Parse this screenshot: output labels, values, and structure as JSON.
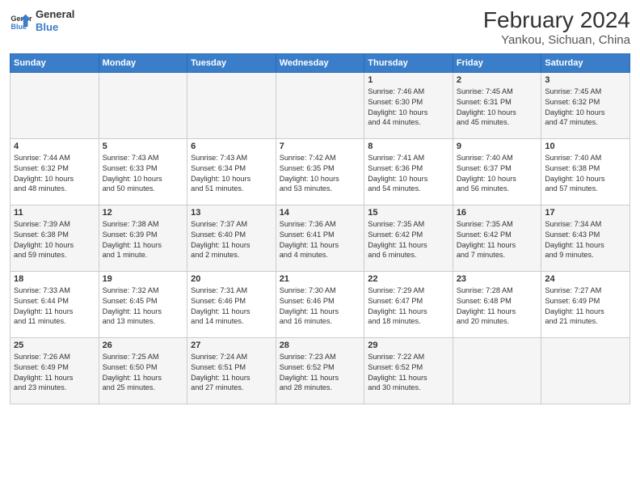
{
  "logo": {
    "line1": "General",
    "line2": "Blue"
  },
  "title": "February 2024",
  "subtitle": "Yankou, Sichuan, China",
  "days_of_week": [
    "Sunday",
    "Monday",
    "Tuesday",
    "Wednesday",
    "Thursday",
    "Friday",
    "Saturday"
  ],
  "weeks": [
    [
      {
        "day": "",
        "info": ""
      },
      {
        "day": "",
        "info": ""
      },
      {
        "day": "",
        "info": ""
      },
      {
        "day": "",
        "info": ""
      },
      {
        "day": "1",
        "info": "Sunrise: 7:46 AM\nSunset: 6:30 PM\nDaylight: 10 hours\nand 44 minutes."
      },
      {
        "day": "2",
        "info": "Sunrise: 7:45 AM\nSunset: 6:31 PM\nDaylight: 10 hours\nand 45 minutes."
      },
      {
        "day": "3",
        "info": "Sunrise: 7:45 AM\nSunset: 6:32 PM\nDaylight: 10 hours\nand 47 minutes."
      }
    ],
    [
      {
        "day": "4",
        "info": "Sunrise: 7:44 AM\nSunset: 6:32 PM\nDaylight: 10 hours\nand 48 minutes."
      },
      {
        "day": "5",
        "info": "Sunrise: 7:43 AM\nSunset: 6:33 PM\nDaylight: 10 hours\nand 50 minutes."
      },
      {
        "day": "6",
        "info": "Sunrise: 7:43 AM\nSunset: 6:34 PM\nDaylight: 10 hours\nand 51 minutes."
      },
      {
        "day": "7",
        "info": "Sunrise: 7:42 AM\nSunset: 6:35 PM\nDaylight: 10 hours\nand 53 minutes."
      },
      {
        "day": "8",
        "info": "Sunrise: 7:41 AM\nSunset: 6:36 PM\nDaylight: 10 hours\nand 54 minutes."
      },
      {
        "day": "9",
        "info": "Sunrise: 7:40 AM\nSunset: 6:37 PM\nDaylight: 10 hours\nand 56 minutes."
      },
      {
        "day": "10",
        "info": "Sunrise: 7:40 AM\nSunset: 6:38 PM\nDaylight: 10 hours\nand 57 minutes."
      }
    ],
    [
      {
        "day": "11",
        "info": "Sunrise: 7:39 AM\nSunset: 6:38 PM\nDaylight: 10 hours\nand 59 minutes."
      },
      {
        "day": "12",
        "info": "Sunrise: 7:38 AM\nSunset: 6:39 PM\nDaylight: 11 hours\nand 1 minute."
      },
      {
        "day": "13",
        "info": "Sunrise: 7:37 AM\nSunset: 6:40 PM\nDaylight: 11 hours\nand 2 minutes."
      },
      {
        "day": "14",
        "info": "Sunrise: 7:36 AM\nSunset: 6:41 PM\nDaylight: 11 hours\nand 4 minutes."
      },
      {
        "day": "15",
        "info": "Sunrise: 7:35 AM\nSunset: 6:42 PM\nDaylight: 11 hours\nand 6 minutes."
      },
      {
        "day": "16",
        "info": "Sunrise: 7:35 AM\nSunset: 6:42 PM\nDaylight: 11 hours\nand 7 minutes."
      },
      {
        "day": "17",
        "info": "Sunrise: 7:34 AM\nSunset: 6:43 PM\nDaylight: 11 hours\nand 9 minutes."
      }
    ],
    [
      {
        "day": "18",
        "info": "Sunrise: 7:33 AM\nSunset: 6:44 PM\nDaylight: 11 hours\nand 11 minutes."
      },
      {
        "day": "19",
        "info": "Sunrise: 7:32 AM\nSunset: 6:45 PM\nDaylight: 11 hours\nand 13 minutes."
      },
      {
        "day": "20",
        "info": "Sunrise: 7:31 AM\nSunset: 6:46 PM\nDaylight: 11 hours\nand 14 minutes."
      },
      {
        "day": "21",
        "info": "Sunrise: 7:30 AM\nSunset: 6:46 PM\nDaylight: 11 hours\nand 16 minutes."
      },
      {
        "day": "22",
        "info": "Sunrise: 7:29 AM\nSunset: 6:47 PM\nDaylight: 11 hours\nand 18 minutes."
      },
      {
        "day": "23",
        "info": "Sunrise: 7:28 AM\nSunset: 6:48 PM\nDaylight: 11 hours\nand 20 minutes."
      },
      {
        "day": "24",
        "info": "Sunrise: 7:27 AM\nSunset: 6:49 PM\nDaylight: 11 hours\nand 21 minutes."
      }
    ],
    [
      {
        "day": "25",
        "info": "Sunrise: 7:26 AM\nSunset: 6:49 PM\nDaylight: 11 hours\nand 23 minutes."
      },
      {
        "day": "26",
        "info": "Sunrise: 7:25 AM\nSunset: 6:50 PM\nDaylight: 11 hours\nand 25 minutes."
      },
      {
        "day": "27",
        "info": "Sunrise: 7:24 AM\nSunset: 6:51 PM\nDaylight: 11 hours\nand 27 minutes."
      },
      {
        "day": "28",
        "info": "Sunrise: 7:23 AM\nSunset: 6:52 PM\nDaylight: 11 hours\nand 28 minutes."
      },
      {
        "day": "29",
        "info": "Sunrise: 7:22 AM\nSunset: 6:52 PM\nDaylight: 11 hours\nand 30 minutes."
      },
      {
        "day": "",
        "info": ""
      },
      {
        "day": "",
        "info": ""
      }
    ]
  ]
}
